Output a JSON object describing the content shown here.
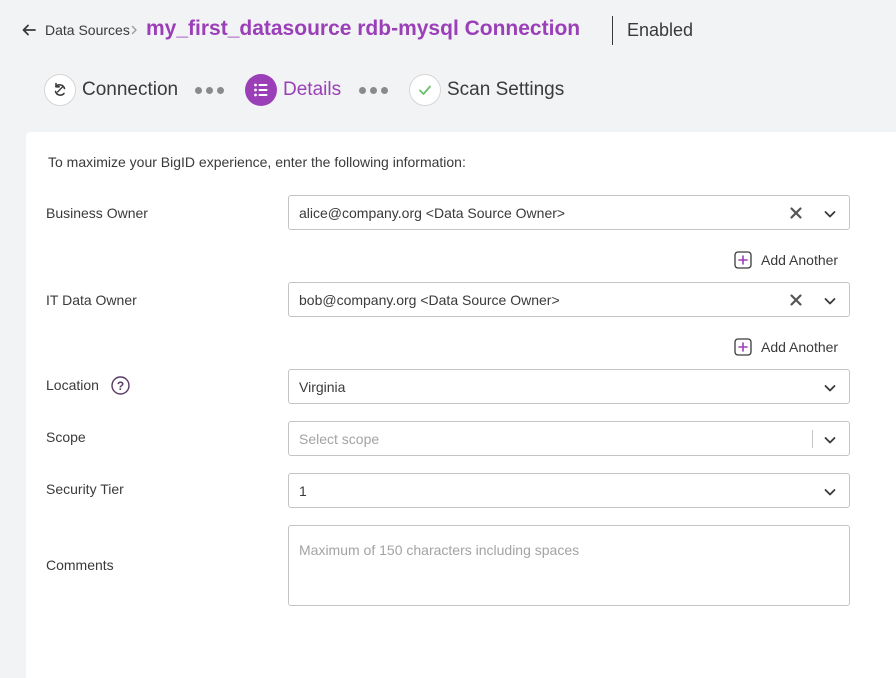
{
  "header": {
    "breadcrumb": "Data Sources",
    "title": "my_first_datasource rdb-mysql Connection",
    "status": "Enabled"
  },
  "steps": [
    {
      "label": "Connection",
      "icon": "reconnect-icon",
      "state": "done"
    },
    {
      "label": "Details",
      "icon": "list-icon",
      "state": "active"
    },
    {
      "label": "Scan Settings",
      "icon": "check-icon",
      "state": "done"
    }
  ],
  "form": {
    "intro": "To maximize your BigID experience, enter the following information:",
    "business_owner": {
      "label": "Business Owner",
      "value": "alice@company.org <Data Source Owner>"
    },
    "it_data_owner": {
      "label": "IT Data Owner",
      "value": "bob@company.org <Data Source Owner>"
    },
    "add_another": "Add Another",
    "location": {
      "label": "Location",
      "value": "Virginia"
    },
    "scope": {
      "label": "Scope",
      "placeholder": "Select scope"
    },
    "security_tier": {
      "label": "Security Tier",
      "value": "1"
    },
    "comments": {
      "label": "Comments",
      "placeholder": "Maximum of 150 characters including spaces"
    }
  },
  "colors": {
    "accent": "#9b3fb8",
    "check": "#6cbf6c",
    "text": "#3a3a3a",
    "background": "#f2f3f5"
  }
}
